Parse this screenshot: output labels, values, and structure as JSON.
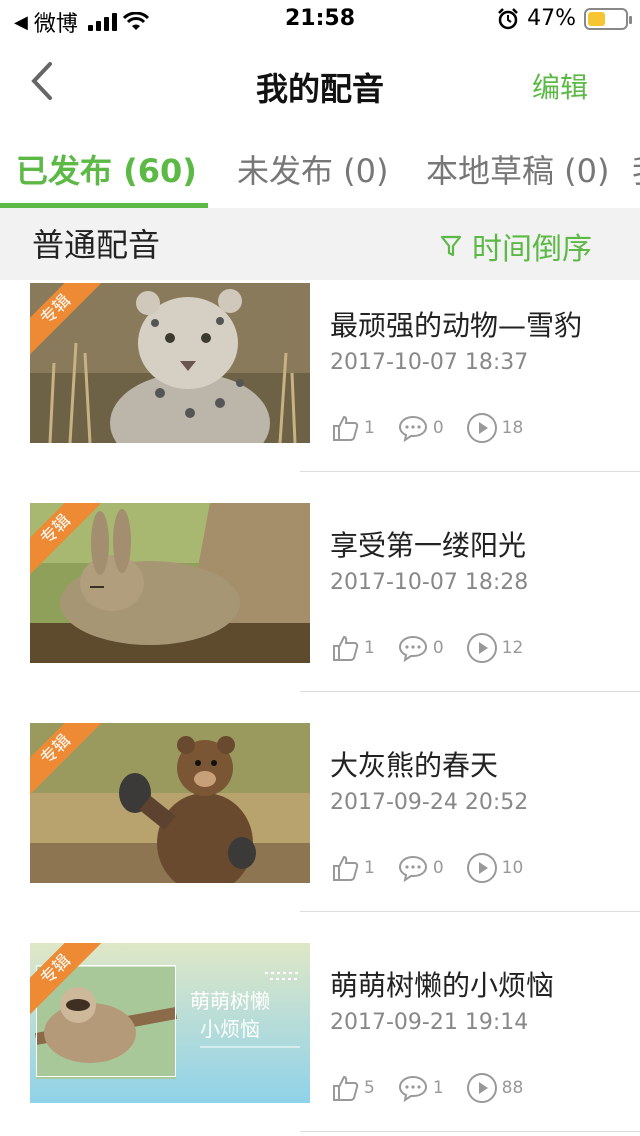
{
  "status_bar": {
    "carrier": "微博",
    "time": "21:58",
    "battery": "47%",
    "battery_level": 0.47,
    "icons": [
      "back-arrow-icon",
      "signal-icon",
      "wifi-icon",
      "alarm-icon",
      "battery-icon"
    ]
  },
  "nav": {
    "title": "我的配音",
    "edit_label": "编辑",
    "back_icon": "chevron-left-icon"
  },
  "tabs": [
    {
      "label": "已发布 (60)",
      "active": true
    },
    {
      "label": "未发布 (0)",
      "active": false
    },
    {
      "label": "本地草稿 (0)",
      "active": false
    },
    {
      "label": "我",
      "active": false
    }
  ],
  "filter": {
    "title": "普通配音",
    "sort_label": "时间倒序",
    "sort_icon": "filter-icon"
  },
  "colors": {
    "accent": "#5cb946",
    "ribbon": "#ee8a34",
    "battery_fill": "#f6c531"
  },
  "items": [
    {
      "badge": "专辑",
      "title": "最顽强的动物—雪豹",
      "date": "2017-10-07 18:37",
      "likes": "1",
      "comments": "0",
      "plays": "18",
      "image": "snow-leopard"
    },
    {
      "badge": "专辑",
      "title": "享受第一缕阳光",
      "date": "2017-10-07 18:28",
      "likes": "1",
      "comments": "0",
      "plays": "12",
      "image": "chinchilla"
    },
    {
      "badge": "专辑",
      "title": "大灰熊的春天",
      "date": "2017-09-24 20:52",
      "likes": "1",
      "comments": "0",
      "plays": "10",
      "image": "grizzly-bear"
    },
    {
      "badge": "专辑",
      "title": "萌萌树懒的小烦恼",
      "date": "2017-09-21 19:14",
      "likes": "5",
      "comments": "1",
      "plays": "88",
      "image": "sloth",
      "image_text": [
        "萌萌树懒",
        "小烦恼"
      ]
    }
  ]
}
